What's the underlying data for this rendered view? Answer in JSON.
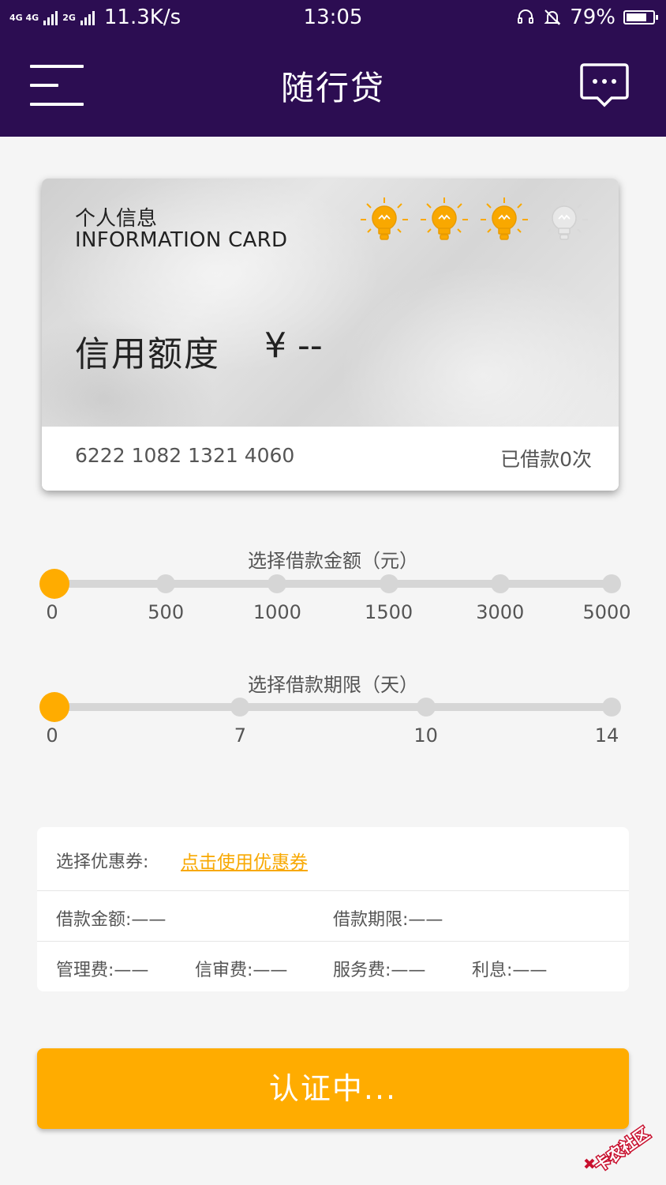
{
  "status_bar": {
    "network": "4G 4G",
    "network2": "2G",
    "speed": "11.3K/s",
    "time": "13:05",
    "battery": "79%",
    "battery_level": 0.79
  },
  "header": {
    "title": "随行贷",
    "menu_icon": "hamburger-menu-icon",
    "message_icon": "chat-bubble-icon"
  },
  "card": {
    "title_cn": "个人信息",
    "title_en": "INFORMATION CARD",
    "credit_rating": {
      "lit": 3,
      "total": 4
    },
    "credit_label": "信用额度",
    "credit_value": "¥ --",
    "card_number": "6222 1082 1321 4060",
    "borrow_count": "已借款0次"
  },
  "amount_slider": {
    "title": "选择借款金额（元）",
    "ticks": [
      "0",
      "500",
      "1000",
      "1500",
      "3000",
      "5000"
    ],
    "selected": "0"
  },
  "term_slider": {
    "title": "选择借款期限（天）",
    "ticks": [
      "0",
      "7",
      "10",
      "14"
    ],
    "selected": "0"
  },
  "panel": {
    "coupon_label": "选择优惠券:",
    "coupon_link": "点击使用优惠券",
    "loan_amount": "借款金额:——",
    "loan_term": "借款期限:——",
    "management_fee": "管理费:——",
    "review_fee": "信审费:——",
    "service_fee": "服务费:——",
    "interest": "利息:——"
  },
  "submit_button": "认证中...",
  "watermark": "卡农社区",
  "colors": {
    "header_bg": "#2c0d52",
    "accent": "#ffac00",
    "page_bg": "#f5f5f5"
  }
}
